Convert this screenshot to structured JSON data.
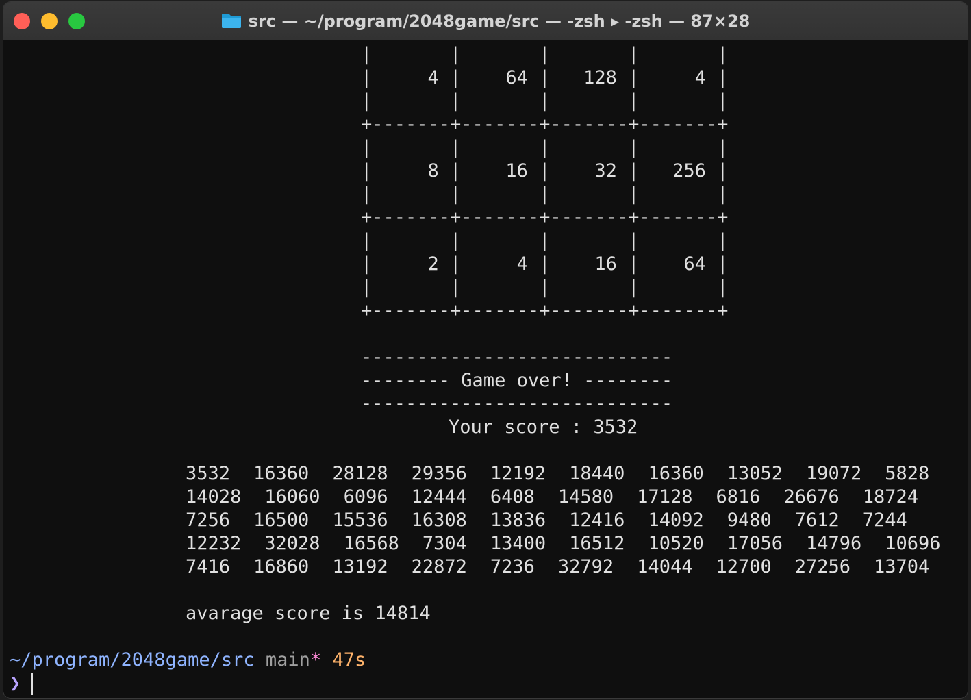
{
  "window": {
    "title": "src — ~/program/2048game/src — -zsh ▸ -zsh — 87×28"
  },
  "colors": {
    "path": "#8fb4ff",
    "branch": "#a0a0a0",
    "dirty_marker": "#ff8ad8",
    "duration": "#ffb36b",
    "prompt_symbol": "#b9a4ff"
  },
  "board": {
    "lines": [
      "|       |       |       |       |",
      "|     4 |    64 |   128 |     4 |",
      "|       |       |       |       |",
      "+-------+-------+-------+-------+",
      "|       |       |       |       |",
      "|     8 |    16 |    32 |   256 |",
      "|       |       |       |       |",
      "+-------+-------+-------+-------+",
      "|       |       |       |       |",
      "|     2 |     4 |    16 |    64 |",
      "|       |       |       |       |",
      "+-------+-------+-------+-------+"
    ]
  },
  "game_over": {
    "rule_top": "----------------------------",
    "message": "-------- Game over! --------",
    "rule_bottom": "----------------------------",
    "score_line": "Your score : 3532"
  },
  "scores": [
    [
      "3532",
      "16360",
      "28128",
      "29356",
      "12192",
      "18440",
      "16360",
      "13052",
      "19072",
      "5828"
    ],
    [
      "14028",
      "16060",
      "6096",
      "12444",
      "6408",
      "14580",
      "17128",
      "6816",
      "26676",
      "18724"
    ],
    [
      "7256",
      "16500",
      "15536",
      "16308",
      "13836",
      "12416",
      "14092",
      "9480",
      "7612",
      "7244"
    ],
    [
      "12232",
      "32028",
      "16568",
      "7304",
      "13400",
      "16512",
      "10520",
      "17056",
      "14796",
      "10696"
    ],
    [
      "7416",
      "16860",
      "13192",
      "22872",
      "7236",
      "32792",
      "14044",
      "12700",
      "27256",
      "13704"
    ]
  ],
  "average_line": "avarage score is 14814",
  "prompt": {
    "path": "~/program/2048game/src",
    "branch": "main",
    "dirty": "*",
    "duration": "47s",
    "symbol": "❯"
  }
}
